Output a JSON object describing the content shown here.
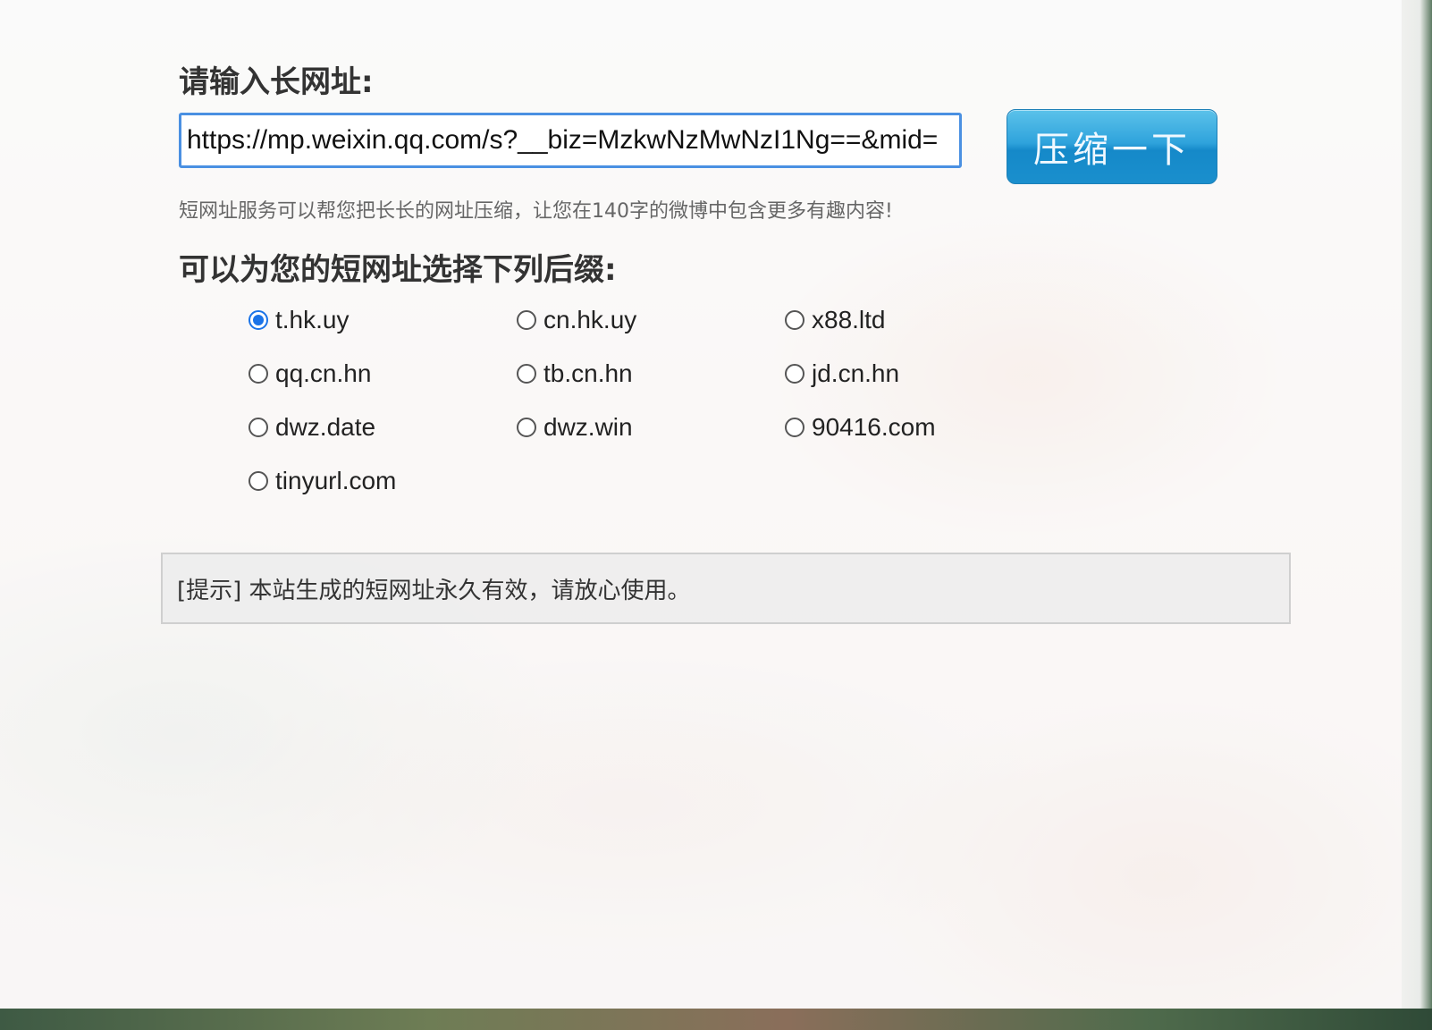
{
  "form": {
    "long_url_heading": "请输入长网址:",
    "long_url_value": "https://mp.weixin.qq.com/s?__biz=MzkwNzMwNzI1Ng==&mid=",
    "compress_button": "压缩一下",
    "service_hint": "短网址服务可以帮您把长长的网址压缩，让您在140字的微博中包含更多有趣内容!",
    "suffix_heading": "可以为您的短网址选择下列后缀:"
  },
  "suffixes": [
    {
      "label": "t.hk.uy",
      "selected": true
    },
    {
      "label": "cn.hk.uy",
      "selected": false
    },
    {
      "label": "x88.ltd",
      "selected": false
    },
    {
      "label": "qq.cn.hn",
      "selected": false
    },
    {
      "label": "tb.cn.hn",
      "selected": false
    },
    {
      "label": "jd.cn.hn",
      "selected": false
    },
    {
      "label": "dwz.date",
      "selected": false
    },
    {
      "label": "dwz.win",
      "selected": false
    },
    {
      "label": "90416.com",
      "selected": false
    },
    {
      "label": "tinyurl.com",
      "selected": false
    }
  ],
  "notice": {
    "text": "[提示] 本站生成的短网址永久有效，请放心使用。"
  },
  "colors": {
    "radio_checked": "#1a73e8",
    "input_border": "#4a90e2",
    "button_blue": "#2fa3dc"
  }
}
